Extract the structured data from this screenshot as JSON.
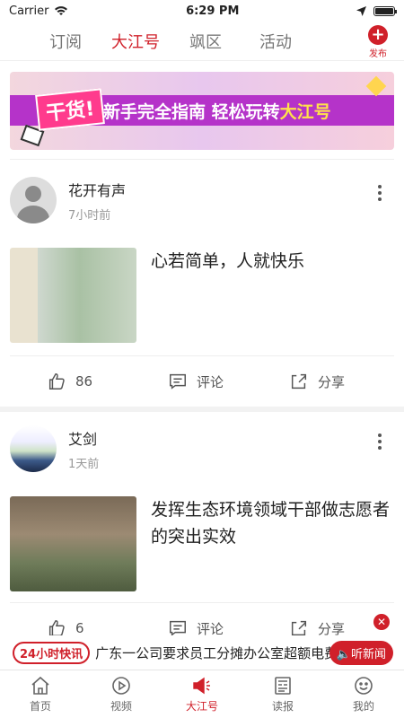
{
  "status_bar": {
    "carrier": "Carrier",
    "time": "6:29 PM"
  },
  "tabs": [
    {
      "label": "订阅",
      "active": false
    },
    {
      "label": "大江号",
      "active": true
    },
    {
      "label": "飒区",
      "active": false
    },
    {
      "label": "活动",
      "active": false
    }
  ],
  "publish": {
    "label": "发布"
  },
  "banner": {
    "tag": "干货!",
    "text_main": "新手完全指南 轻松玩转",
    "text_highlight": "大江号"
  },
  "posts": [
    {
      "author": "花开有声",
      "time": "7小时前",
      "headline": "心若简单，人就快乐",
      "likes": "86",
      "comment_label": "评论",
      "share_label": "分享"
    },
    {
      "author": "艾剑",
      "time": "1天前",
      "headline": "发挥生态环境领域干部做志愿者的突出实效",
      "likes": "6",
      "comment_label": "评论",
      "share_label": "分享"
    }
  ],
  "news_bar": {
    "badge": "24小时快讯",
    "text": "广东一公司要求员工分摊办公室超额电费",
    "listen": "听新闻"
  },
  "tabbar": [
    {
      "label": "首页",
      "icon": "home-icon",
      "active": false
    },
    {
      "label": "视频",
      "icon": "play-icon",
      "active": false
    },
    {
      "label": "大江号",
      "icon": "megaphone-icon",
      "active": true
    },
    {
      "label": "读报",
      "icon": "newspaper-icon",
      "active": false
    },
    {
      "label": "我的",
      "icon": "smiley-icon",
      "active": false
    }
  ],
  "colors": {
    "accent": "#d0202a",
    "text": "#222222",
    "muted": "#999999"
  }
}
